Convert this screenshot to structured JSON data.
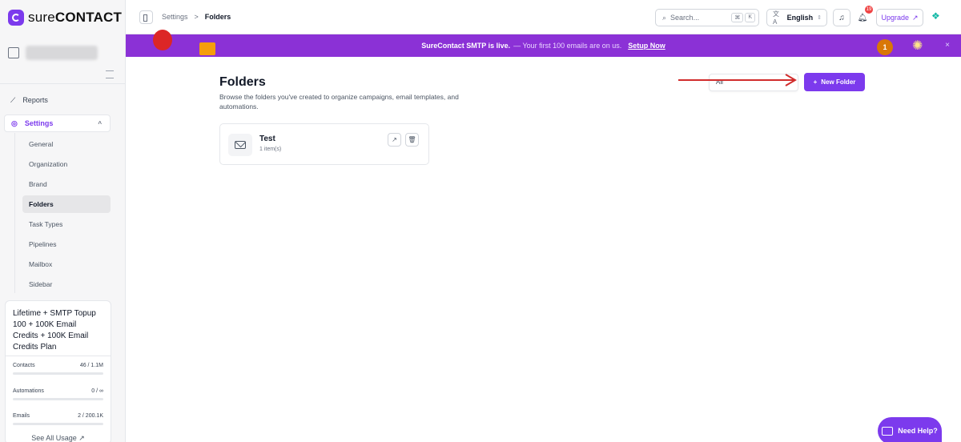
{
  "brand": {
    "name_prefix": "sure",
    "name_suffix": "CONTACT",
    "accent": "#7c3aed",
    "banner_color": "#8b31d6"
  },
  "sidebar": {
    "nav": [
      {
        "label": "Reports",
        "icon": "chart-line-icon"
      },
      {
        "label": "Settings",
        "icon": "gear-icon"
      }
    ],
    "sub_items": [
      {
        "label": "General"
      },
      {
        "label": "Organization"
      },
      {
        "label": "Brand"
      },
      {
        "label": "Folders"
      },
      {
        "label": "Task Types"
      },
      {
        "label": "Pipelines"
      },
      {
        "label": "Mailbox"
      },
      {
        "label": "Sidebar"
      }
    ],
    "plan": {
      "title": "Lifetime + SMTP Topup 100 + 100K Email Credits + 100K Email Credits Plan",
      "usage": [
        {
          "label": "Contacts",
          "value": "46 / 1.1M",
          "fill": 4e-05
        },
        {
          "label": "Automations",
          "value": "0 / ∞",
          "fill": 0
        },
        {
          "label": "Emails",
          "value": "2 / 200.1K",
          "fill": 1e-05
        }
      ],
      "see_all": "See All Usage ↗"
    }
  },
  "topbar": {
    "crumbs": [
      "Settings",
      "Folders"
    ],
    "separator": ">",
    "search_placeholder": "Search...",
    "shortcut": [
      "⌘",
      "K"
    ],
    "language": "English",
    "notifications": "19",
    "upgrade": "Upgrade"
  },
  "banner": {
    "bold": "SureContact SMTP is live.",
    "text": "— Your first 100 emails are on us.",
    "link": "Setup Now",
    "medal": "1"
  },
  "main": {
    "title": "Folders",
    "description": "Browse the folders you've created to organize campaigns, email templates, and automations.",
    "filter_value": "All",
    "new_folder": "New Folder",
    "folders": [
      {
        "name": "Test",
        "count": "1 item(s)"
      }
    ]
  },
  "help": {
    "label": "Need Help?"
  }
}
